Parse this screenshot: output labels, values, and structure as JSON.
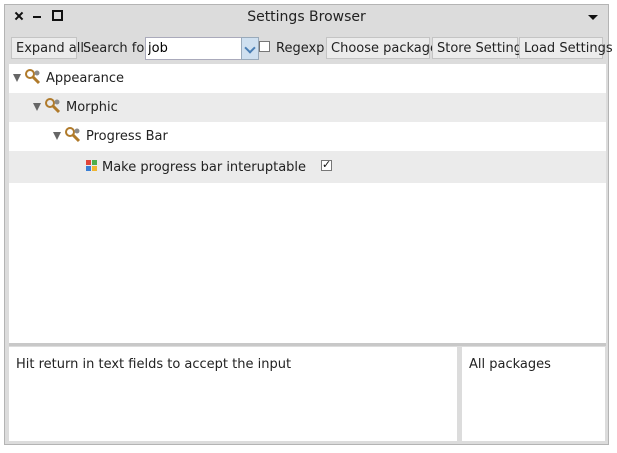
{
  "window": {
    "title": "Settings Browser"
  },
  "toolbar": {
    "expand_all_label": "Expand all",
    "search_label": "Search for:",
    "search_value": "job",
    "regexp_label": "Regexp",
    "regexp_checked": false,
    "choose_packages_label": "Choose packages",
    "store_settings_label": "Store Settings",
    "load_settings_label": "Load Settings"
  },
  "tree": {
    "rows": [
      {
        "label": "Appearance",
        "level": 0,
        "expanded": true,
        "icon": "wrench-icon"
      },
      {
        "label": "Morphic",
        "level": 1,
        "expanded": true,
        "icon": "wrench-icon"
      },
      {
        "label": "Progress Bar",
        "level": 2,
        "expanded": true,
        "icon": "wrench-icon"
      },
      {
        "label": "Make progress bar interuptable",
        "level": 3,
        "icon": "grid-icon",
        "checked": true
      }
    ]
  },
  "status": {
    "message": "Hit return in text fields to accept the input"
  },
  "packages": {
    "label": "All packages"
  },
  "colors": {
    "window_bg": "#dcdcdc",
    "row_alt_bg": "#ebebeb",
    "dropdown_accent": "#4a7fb5",
    "wrench_color": "#b07a2a"
  }
}
